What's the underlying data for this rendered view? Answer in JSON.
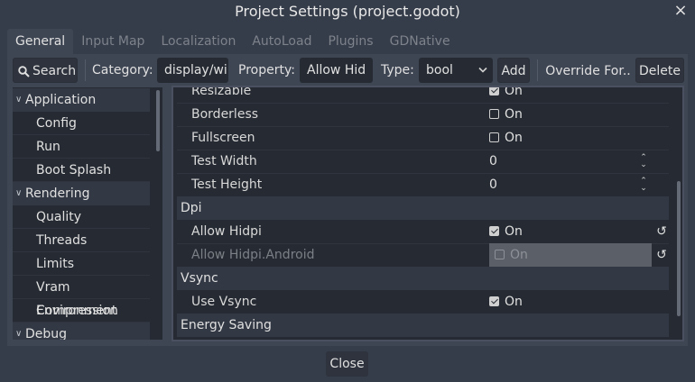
{
  "window": {
    "title": "Project Settings (project.godot)",
    "close_icon": "×"
  },
  "tabs": [
    {
      "label": "General",
      "active": true
    },
    {
      "label": "Input Map"
    },
    {
      "label": "Localization"
    },
    {
      "label": "AutoLoad"
    },
    {
      "label": "Plugins"
    },
    {
      "label": "GDNative"
    }
  ],
  "toolbar": {
    "search_label": "Search",
    "category_label": "Category:",
    "category_value": "display/wi",
    "property_label": "Property:",
    "property_value": "Allow Hid",
    "type_label": "Type:",
    "type_value": "bool",
    "add_label": "Add",
    "override_label": "Override For..",
    "delete_label": "Delete"
  },
  "sidebar": {
    "items": [
      {
        "label": "Application",
        "section": true
      },
      {
        "label": "Config"
      },
      {
        "label": "Run"
      },
      {
        "label": "Boot Splash"
      },
      {
        "label": "Rendering",
        "section": true
      },
      {
        "label": "Quality"
      },
      {
        "label": "Threads"
      },
      {
        "label": "Limits"
      },
      {
        "label": "Vram Compression"
      },
      {
        "label": "Environment"
      },
      {
        "label": "Debug",
        "section": true
      }
    ]
  },
  "properties": {
    "resizable": {
      "name": "Resizable",
      "value": "On",
      "checked": true
    },
    "borderless": {
      "name": "Borderless",
      "value": "On",
      "checked": false
    },
    "fullscreen": {
      "name": "Fullscreen",
      "value": "On",
      "checked": false
    },
    "test_width": {
      "name": "Test Width",
      "value": "0"
    },
    "test_height": {
      "name": "Test Height",
      "value": "0"
    },
    "dpi_section": "Dpi",
    "allow_hidpi": {
      "name": "Allow Hidpi",
      "value": "On",
      "checked": true
    },
    "allow_hidpi_android": {
      "name": "Allow Hidpi.Android",
      "value": "On",
      "checked": false
    },
    "vsync_section": "Vsync",
    "use_vsync": {
      "name": "Use Vsync",
      "value": "On",
      "checked": true
    },
    "energy_section": "Energy Saving"
  },
  "footer": {
    "close_label": "Close"
  },
  "colors": {
    "background": "#363d4a",
    "panel": "#3e4553",
    "field": "#262b33",
    "text": "#e0e0e0"
  }
}
